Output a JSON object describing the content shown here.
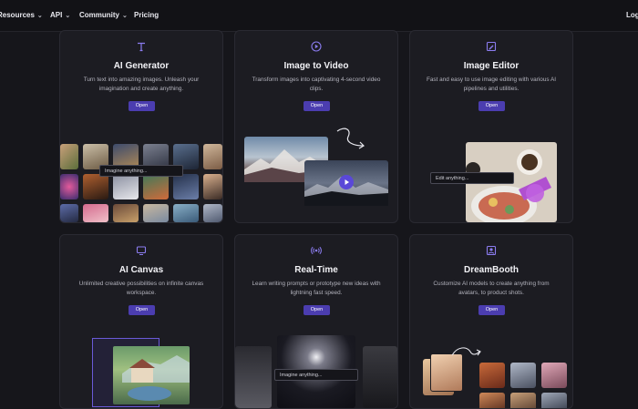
{
  "nav": {
    "items": [
      {
        "label": "Resources"
      },
      {
        "label": "API"
      },
      {
        "label": "Community"
      },
      {
        "label": "Pricing"
      }
    ],
    "login_label": "Log"
  },
  "cards": [
    {
      "title": "AI Generator",
      "description": "Turn text into amazing images. Unleash your imagination and create anything.",
      "button": "Open",
      "icon": "text-icon",
      "prompt": "Imagine anything..."
    },
    {
      "title": "Image to Video",
      "description": "Transform images into captivating 4-second video clips.",
      "button": "Open",
      "icon": "play-circle-icon"
    },
    {
      "title": "Image Editor",
      "description": "Fast and easy to use image editing with various AI pipelines and utilities.",
      "button": "Open",
      "icon": "image-edit-icon",
      "prompt": "Edit anything..."
    },
    {
      "title": "AI Canvas",
      "description": "Unlimited creative possibilities on infinite canvas workspace.",
      "button": "Open",
      "icon": "monitor-icon"
    },
    {
      "title": "Real-Time",
      "description": "Learn writing prompts or prototype new ideas with lightning fast speed.",
      "button": "Open",
      "icon": "broadcast-icon",
      "prompt": "Imagine anything..."
    },
    {
      "title": "DreamBooth",
      "description": "Customize AI models to create anything from avatars, to product shots.",
      "button": "Open",
      "icon": "portrait-icon"
    }
  ],
  "colors": {
    "accent": "#4b3db0",
    "icon": "#8b7cf0",
    "background": "#16161b",
    "card": "#1c1c22"
  }
}
